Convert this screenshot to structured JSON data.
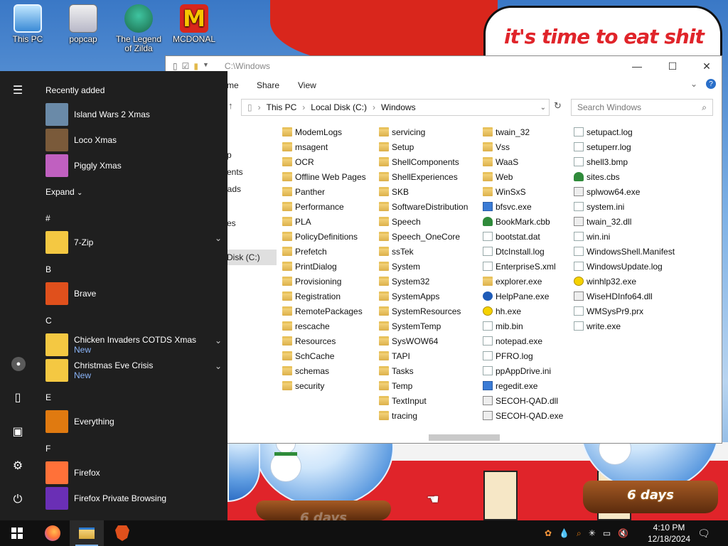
{
  "desktop": {
    "banner_text": "it's time to eat shit",
    "icons": [
      {
        "label": "This PC"
      },
      {
        "label": "popcap"
      },
      {
        "label": "The Legend of Zilda"
      },
      {
        "label": "MCDONAL"
      }
    ],
    "globe_right_label": "6 days",
    "globe_left_label": "6 days"
  },
  "explorer": {
    "title_path": "C:\\Windows",
    "ribbon_tabs": [
      "me",
      "Share",
      "View"
    ],
    "address": [
      "This PC",
      "Local Disk (C:)",
      "Windows"
    ],
    "search_placeholder": "Search Windows",
    "nav_partial": [
      "p",
      "ments",
      "oads",
      "es",
      "Disk (C:)"
    ],
    "columns": [
      [
        {
          "name": "ModemLogs",
          "icon": "folder"
        },
        {
          "name": "msagent",
          "icon": "folder"
        },
        {
          "name": "OCR",
          "icon": "folder"
        },
        {
          "name": "Offline Web Pages",
          "icon": "folder"
        },
        {
          "name": "Panther",
          "icon": "folder"
        },
        {
          "name": "Performance",
          "icon": "folder"
        },
        {
          "name": "PLA",
          "icon": "folder"
        },
        {
          "name": "PolicyDefinitions",
          "icon": "folder"
        },
        {
          "name": "Prefetch",
          "icon": "folder"
        },
        {
          "name": "PrintDialog",
          "icon": "folder"
        },
        {
          "name": "Provisioning",
          "icon": "folder"
        },
        {
          "name": "Registration",
          "icon": "folder"
        },
        {
          "name": "RemotePackages",
          "icon": "folder"
        },
        {
          "name": "rescache",
          "icon": "folder"
        },
        {
          "name": "Resources",
          "icon": "folder"
        },
        {
          "name": "SchCache",
          "icon": "folder"
        },
        {
          "name": "schemas",
          "icon": "folder"
        },
        {
          "name": "security",
          "icon": "folder"
        }
      ],
      [
        {
          "name": "servicing",
          "icon": "folder"
        },
        {
          "name": "Setup",
          "icon": "folder"
        },
        {
          "name": "ShellComponents",
          "icon": "folder"
        },
        {
          "name": "ShellExperiences",
          "icon": "folder"
        },
        {
          "name": "SKB",
          "icon": "folder"
        },
        {
          "name": "SoftwareDistribution",
          "icon": "folder"
        },
        {
          "name": "Speech",
          "icon": "folder"
        },
        {
          "name": "Speech_OneCore",
          "icon": "folder"
        },
        {
          "name": "ssTek",
          "icon": "folder"
        },
        {
          "name": "System",
          "icon": "folder"
        },
        {
          "name": "System32",
          "icon": "folder"
        },
        {
          "name": "SystemApps",
          "icon": "folder"
        },
        {
          "name": "SystemResources",
          "icon": "folder"
        },
        {
          "name": "SystemTemp",
          "icon": "folder"
        },
        {
          "name": "SysWOW64",
          "icon": "folder"
        },
        {
          "name": "TAPI",
          "icon": "folder"
        },
        {
          "name": "Tasks",
          "icon": "folder"
        },
        {
          "name": "Temp",
          "icon": "folder"
        },
        {
          "name": "TextInput",
          "icon": "folder"
        },
        {
          "name": "tracing",
          "icon": "folder"
        }
      ],
      [
        {
          "name": "twain_32",
          "icon": "folder"
        },
        {
          "name": "Vss",
          "icon": "folder"
        },
        {
          "name": "WaaS",
          "icon": "folder"
        },
        {
          "name": "Web",
          "icon": "folder"
        },
        {
          "name": "WinSxS",
          "icon": "folder"
        },
        {
          "name": "bfsvc.exe",
          "icon": "exe"
        },
        {
          "name": "BookMark.cbb",
          "icon": "tree"
        },
        {
          "name": "bootstat.dat",
          "icon": "doc"
        },
        {
          "name": "DtcInstall.log",
          "icon": "doc"
        },
        {
          "name": "EnterpriseS.xml",
          "icon": "doc"
        },
        {
          "name": "explorer.exe",
          "icon": "folder"
        },
        {
          "name": "HelpPane.exe",
          "icon": "helpb"
        },
        {
          "name": "hh.exe",
          "icon": "help"
        },
        {
          "name": "mib.bin",
          "icon": "doc"
        },
        {
          "name": "notepad.exe",
          "icon": "doc"
        },
        {
          "name": "PFRO.log",
          "icon": "doc"
        },
        {
          "name": "ppAppDrive.ini",
          "icon": "doc"
        },
        {
          "name": "regedit.exe",
          "icon": "exe"
        },
        {
          "name": "SECOH-QAD.dll",
          "icon": "dll"
        },
        {
          "name": "SECOH-QAD.exe",
          "icon": "dll"
        }
      ],
      [
        {
          "name": "setupact.log",
          "icon": "doc"
        },
        {
          "name": "setuperr.log",
          "icon": "doc"
        },
        {
          "name": "shell3.bmp",
          "icon": "doc"
        },
        {
          "name": "sites.cbs",
          "icon": "tree"
        },
        {
          "name": "splwow64.exe",
          "icon": "dll"
        },
        {
          "name": "system.ini",
          "icon": "doc"
        },
        {
          "name": "twain_32.dll",
          "icon": "dll"
        },
        {
          "name": "win.ini",
          "icon": "doc"
        },
        {
          "name": "WindowsShell.Manifest",
          "icon": "doc"
        },
        {
          "name": "WindowsUpdate.log",
          "icon": "doc"
        },
        {
          "name": "winhlp32.exe",
          "icon": "help"
        },
        {
          "name": "WiseHDInfo64.dll",
          "icon": "dll"
        },
        {
          "name": "WMSysPr9.prx",
          "icon": "doc"
        },
        {
          "name": "write.exe",
          "icon": "doc"
        }
      ]
    ]
  },
  "start_menu": {
    "recently_added_title": "Recently added",
    "recent": [
      {
        "name": "Island Wars 2 Xmas",
        "color": "#6a8aa8"
      },
      {
        "name": "Loco Xmas",
        "color": "#7a5a3a"
      },
      {
        "name": "Piggly Xmas",
        "color": "#c060c0"
      }
    ],
    "expand_label": "Expand",
    "sections": [
      {
        "letter": "#",
        "apps": [
          {
            "name": "7-Zip",
            "sub": "",
            "color": "#f4c842",
            "chevron": true
          }
        ]
      },
      {
        "letter": "B",
        "apps": [
          {
            "name": "Brave",
            "sub": "",
            "color": "#e0501c",
            "chevron": false
          }
        ]
      },
      {
        "letter": "C",
        "apps": [
          {
            "name": "Chicken Invaders COTDS Xmas",
            "sub": "New",
            "color": "#f4c842",
            "chevron": true
          },
          {
            "name": "Christmas Eve Crisis",
            "sub": "New",
            "color": "#f4c842",
            "chevron": true
          }
        ]
      },
      {
        "letter": "E",
        "apps": [
          {
            "name": "Everything",
            "sub": "",
            "color": "#e07a10",
            "chevron": false
          }
        ]
      },
      {
        "letter": "F",
        "apps": [
          {
            "name": "Firefox",
            "sub": "",
            "color": "#ff7139",
            "chevron": false
          },
          {
            "name": "Firefox Private Browsing",
            "sub": "",
            "color": "#6a2fb5",
            "chevron": false
          }
        ]
      }
    ]
  },
  "taskbar": {
    "apps": [
      "start-icon",
      "firefox-icon",
      "file-explorer-icon",
      "brave-icon"
    ],
    "clock_time": "4:10 PM",
    "clock_date": "12/18/2024"
  },
  "colors": {
    "start_bg": "#1f1f1f",
    "taskbar_bg": "#101010",
    "accent": "#8ab4f8",
    "banner_text": "#e0242a"
  }
}
